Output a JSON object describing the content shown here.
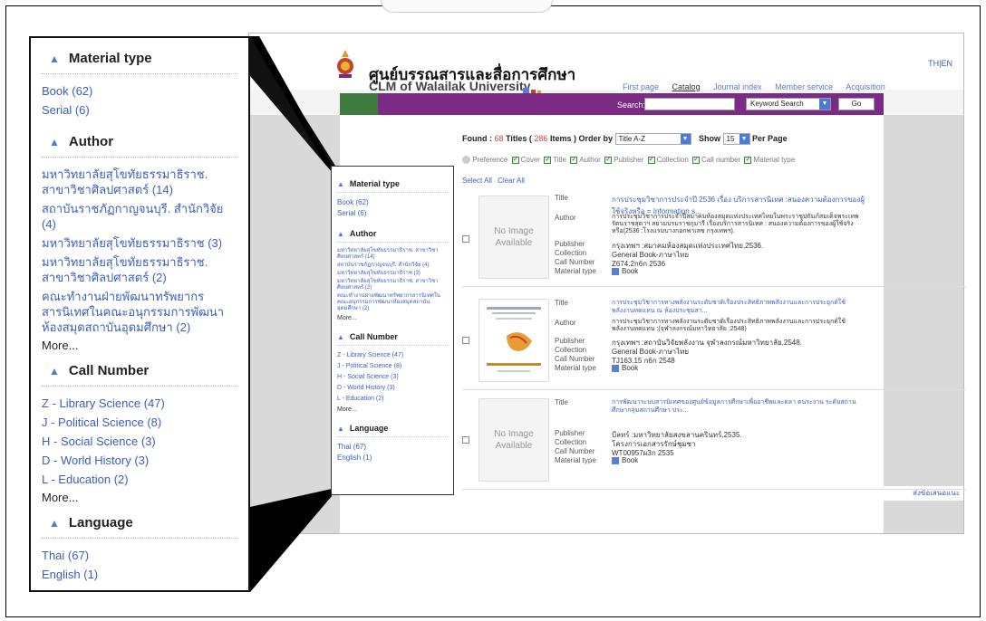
{
  "header": {
    "title_th": "ศูนย์บรรณสารและสื่อการศึกษา",
    "title_en": "CLM of Walailak University",
    "lang_links": "TH|EN",
    "nav": [
      "First page",
      "Catalog",
      "Journal index",
      "Member service",
      "Acquisition"
    ],
    "nav_active": "Catalog"
  },
  "search": {
    "label": "Search:",
    "value": "",
    "type_selected": "Keyword Search",
    "go_label": "Go"
  },
  "results": {
    "found_label": "Found :",
    "titles_count": "68",
    "titles_label": "Titles (",
    "items_count": "286",
    "items_label": "Items ) Order by",
    "order_selected": "Title A-Z",
    "show_label": "Show",
    "show_selected": "15",
    "per_page_label": "Per Page",
    "preference_label": "Preference",
    "display_options": [
      "Cover",
      "Title",
      "Author",
      "Publisher",
      "Collection",
      "Call number",
      "Material type"
    ],
    "select_all": "Select All",
    "clear_all": "Clear All",
    "no_image_line1": "No Image",
    "no_image_line2": "Available",
    "records": [
      {
        "title": "การประชุมวิชาการประจำปี 2536 เรื่อง บริการสารนิเทศ :สนองความต้องการของผู้ใช้จริงหรือ = Information s...",
        "author": "การประชุมวิชาการประจำปีสมาคมห้องสมุดแห่งประเทศไทยในพระราชูปถัมภ์สมเด็จพระเทพรัตนราชสุดาฯ สยามบรมราชกุมารี เรื่องบริการสารนิเทศ : สนองความต้องการของผู้ใช้จริงหรือ(2536 :โรงแรมบางกอกพาเลซ กรุงเทพฯ).",
        "publisher": "กรุงเทพฯ :สมาคมห้องสมุดแห่งประเทศไทย,2536.",
        "collection": "General Book-ภาษาไทย",
        "call_number": "Z674.2ก6ก 2536",
        "material_type": "Book"
      },
      {
        "title": "การประชุมวิชาการทางพลังงานระดับชาติเรื่องประสิทธิภาพพลังงานและการประยุกต์ใช้พลังงานทดแทน ณ ห้องประชุมสา...",
        "author": "การประชุมวิชาการทางพลังงานระดับชาติเรื่องประสิทธิภาพพลังงานและการประยุกต์ใช้พลังงานทดแทน :(จุฬาลงกรณ์มหาวิทยาลัย :2548)",
        "publisher": "กรุงเทพฯ :สถาบันวิจัยพลังงาน จุฬาลงกรณ์มหาวิทยาลัย,2548.",
        "collection": "General Book-ภาษาไทย",
        "call_number": "TJ163.15 ก6ก 2548",
        "material_type": "Book"
      },
      {
        "title": "การพัฒนาระบบสารนิเทศของศูนย์ข้อมูลการศึกษาเพื่ออาชีพและดลา ตนระงาน ระดับสถานศึกษากลุ่มสถานศึกษา ประ...",
        "publisher": "บีลทร์ :มหาวิทยาลัยสงขลานครินทร์,2535.",
        "collection": "โครงการเอกสารรักษ์ชุมชา",
        "call_number": "WT00957ผ3ก 2535",
        "material_type": "Book"
      }
    ],
    "field_labels": {
      "title": "Title",
      "author": "Author",
      "publisher": "Publisher",
      "collection": "Collection",
      "call_number": "Call Number",
      "material_type": "Material type"
    }
  },
  "feedback_link": "ส่งข้อเสนอแนะ",
  "facets": {
    "material_type": {
      "heading": "Material type",
      "items": [
        "Book (62)",
        "Serial (6)"
      ]
    },
    "author": {
      "heading": "Author",
      "items": [
        "มหาวิทยาลัยสุโขทัยธรรมาธิราช. สาขาวิชาศิลปศาสตร์ (14)",
        "สถาบันราชภัฏกาญจนบุรี. สำนักวิจัย (4)",
        "มหาวิทยาลัยสุโขทัยธรรมาธิราช (3)",
        "มหาวิทยาลัยสุโขทัยธรรมาธิราช. สาขาวิชาศิลปศาสตร์ (2)",
        "คณะทำงานฝ่ายพัฒนาทรัพยากรสารนิเทศในคณะอนุกรรมการพัฒนาห้องสมุดสถาบันอุดมศึกษา (2)"
      ],
      "more": "More..."
    },
    "call_number": {
      "heading": "Call Number",
      "items": [
        "Z - Library Science (47)",
        "J - Political Science (8)",
        "H - Social Science (3)",
        "D - World History (3)",
        "L - Education (2)"
      ],
      "more": "More..."
    },
    "language": {
      "heading": "Language",
      "items": [
        "Thai (67)",
        "English (1)"
      ]
    }
  },
  "colors": {
    "purple_bar": "#7b2a86",
    "link": "#3a5fbf",
    "triangle": "#4a7bd6"
  }
}
